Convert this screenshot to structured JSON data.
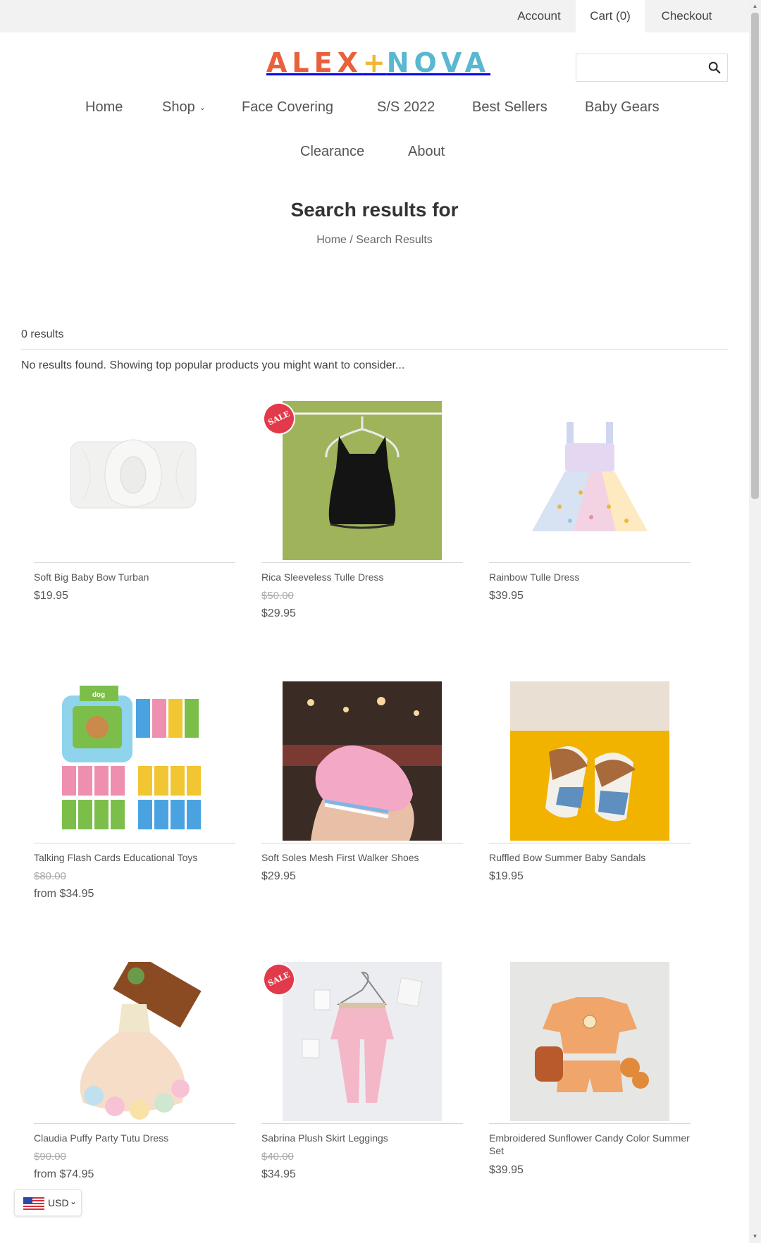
{
  "topbar": {
    "account": "Account",
    "cart": "Cart (0)",
    "checkout": "Checkout"
  },
  "logo": {
    "part1": "ALEX",
    "plus": "+",
    "part2": "NOVA"
  },
  "search": {
    "placeholder": "",
    "icon": "search-icon"
  },
  "nav": {
    "home": "Home",
    "shop": "Shop",
    "face_covering": "Face Covering",
    "ss2022": "S/S 2022",
    "best_sellers": "Best Sellers",
    "baby_gears": "Baby Gears",
    "clearance": "Clearance",
    "about": "About"
  },
  "page": {
    "title": "Search results for",
    "breadcrumb_home": "Home",
    "breadcrumb_sep": " / ",
    "breadcrumb_current": "Search Results",
    "results_count": "0 results",
    "no_results": "No results found. Showing top popular products you might want to consider..."
  },
  "products": [
    {
      "name": "Soft Big Baby Bow Turban",
      "price": "$19.95",
      "compare": "",
      "sale": false
    },
    {
      "name": "Rica Sleeveless Tulle Dress",
      "price": "$29.95",
      "compare": "$50.00",
      "sale": true
    },
    {
      "name": "Rainbow Tulle Dress",
      "price": "$39.95",
      "compare": "",
      "sale": false
    },
    {
      "name": "Talking Flash Cards Educational Toys",
      "price": "from $34.95",
      "compare": "$80.00",
      "sale": false
    },
    {
      "name": "Soft Soles Mesh First Walker Shoes",
      "price": "$29.95",
      "compare": "",
      "sale": false
    },
    {
      "name": "Ruffled Bow Summer Baby Sandals",
      "price": "$19.95",
      "compare": "",
      "sale": false
    },
    {
      "name": "Claudia Puffy Party Tutu Dress",
      "price": "from $74.95",
      "compare": "$90.00",
      "sale": false
    },
    {
      "name": "Sabrina Plush Skirt Leggings",
      "price": "$34.95",
      "compare": "$40.00",
      "sale": true
    },
    {
      "name": "Embroidered Sunflower Candy Color Summer Set",
      "price": "$39.95",
      "compare": "",
      "sale": false
    }
  ],
  "badges": {
    "sale": "SALE"
  },
  "flashcard_word": "dog",
  "currency": {
    "code": "USD"
  },
  "colors": {
    "logo_orange": "#e8603c",
    "logo_yellow": "#f2b632",
    "logo_blue": "#5ab7d0",
    "sale_red": "#e23a4a"
  }
}
